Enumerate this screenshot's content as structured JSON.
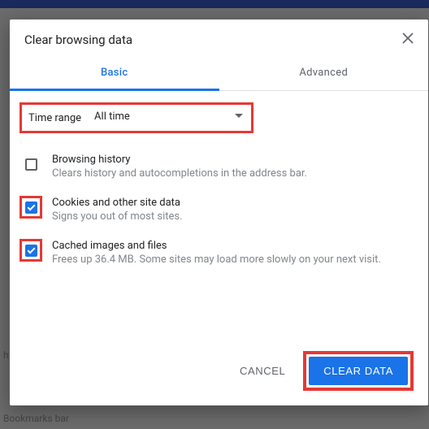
{
  "dialog": {
    "title": "Clear browsing data",
    "tabs": {
      "basic": "Basic",
      "advanced": "Advanced"
    },
    "time_range": {
      "label": "Time range",
      "value": "All time"
    },
    "options": [
      {
        "title": "Browsing history",
        "desc": "Clears history and autocompletions in the address bar.",
        "checked": false,
        "highlighted": false
      },
      {
        "title": "Cookies and other site data",
        "desc": "Signs you out of most sites.",
        "checked": true,
        "highlighted": true
      },
      {
        "title": "Cached images and files",
        "desc": "Frees up 36.4 MB. Some sites may load more slowly on your next visit.",
        "checked": true,
        "highlighted": true
      }
    ],
    "buttons": {
      "cancel": "CANCEL",
      "clear": "CLEAR DATA"
    }
  }
}
